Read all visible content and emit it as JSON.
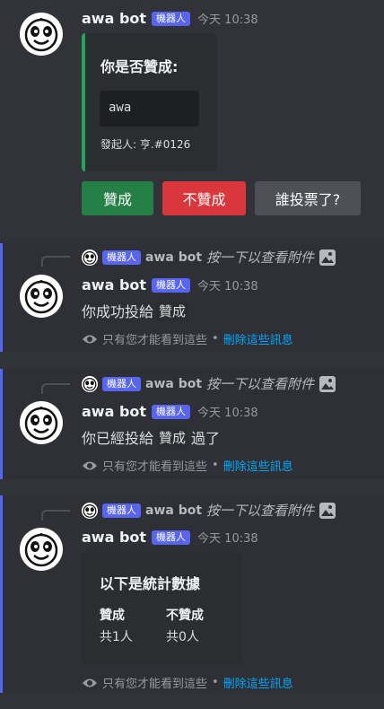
{
  "bot": {
    "name": "awa bot",
    "tag": "機器人",
    "timestamp": "今天 10:38"
  },
  "poll": {
    "title": "你是否贊成:",
    "subject": "awa",
    "initiator": "發起人: 亨.#0126",
    "accent": "#23a55a",
    "buttons": {
      "approve": "贊成",
      "reject": "不贊成",
      "who_voted": "誰投票了?"
    }
  },
  "reply_header": {
    "click_to_view": "按一下以查看附件"
  },
  "ephemeral_note": {
    "text": "只有您才能看到這些",
    "separator": "•",
    "delete_link": "刪除這些訊息"
  },
  "msg1": {
    "prefix": "你成功投給",
    "code": "贊成",
    "suffix": ""
  },
  "msg2": {
    "prefix": "你已經投給",
    "code": "贊成",
    "suffix": "過了"
  },
  "stats": {
    "title": "以下是統計數據",
    "fields": [
      {
        "name": "贊成",
        "value": "共1人"
      },
      {
        "name": "不贊成",
        "value": "共0人"
      }
    ]
  },
  "colors": {
    "approve": "#248046",
    "reject": "#da373c",
    "neutral": "#4e5058",
    "brand": "#5865f2",
    "link": "#00a8fc"
  }
}
